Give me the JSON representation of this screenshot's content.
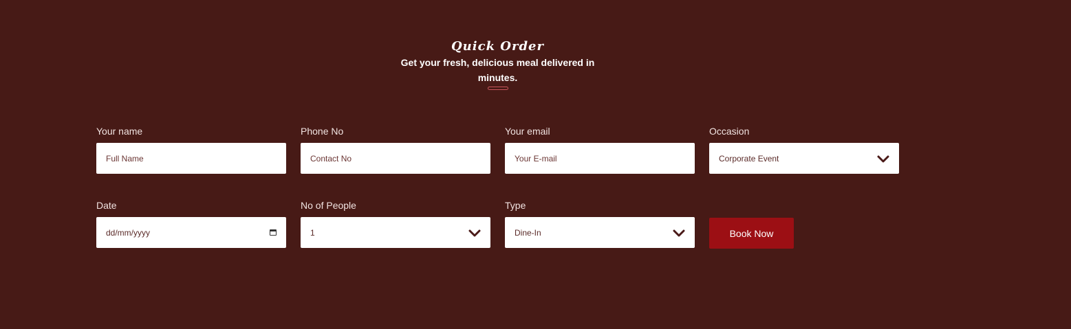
{
  "header": {
    "title": "Quick Order",
    "subtitle": "Get your fresh, delicious meal delivered in minutes."
  },
  "form": {
    "name": {
      "label": "Your name",
      "placeholder": "Full Name"
    },
    "phone": {
      "label": "Phone No",
      "placeholder": "Contact No"
    },
    "email": {
      "label": "Your email",
      "placeholder": "Your E-mail"
    },
    "occasion": {
      "label": "Occasion",
      "value": "Corporate Event"
    },
    "date": {
      "label": "Date",
      "placeholder": "dd/mm/yyyy"
    },
    "people": {
      "label": "No of People",
      "value": "1"
    },
    "type": {
      "label": "Type",
      "value": "Dine-In"
    },
    "submit_label": "Book Now"
  },
  "colors": {
    "background": "#471a16",
    "button": "#9c0f14",
    "input_background": "#ffffff"
  },
  "icons": {
    "select": "chevron-down-icon",
    "date": "calendar-icon"
  }
}
